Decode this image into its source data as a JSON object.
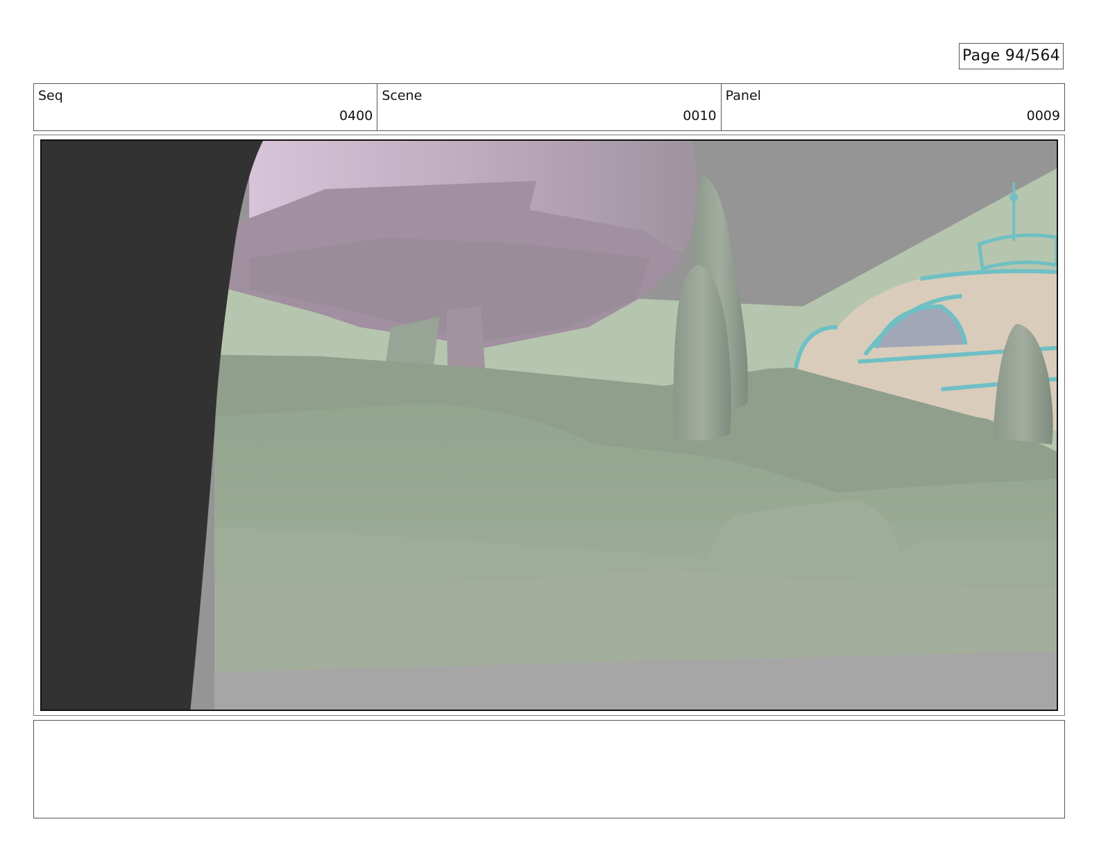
{
  "page": {
    "label": "Page",
    "number": "94/564"
  },
  "header": {
    "seq": {
      "label": "Seq",
      "value": "0400"
    },
    "scene": {
      "label": "Scene",
      "value": "0010"
    },
    "panel": {
      "label": "Panel",
      "value": "0009"
    }
  },
  "notes": {
    "text": ""
  }
}
